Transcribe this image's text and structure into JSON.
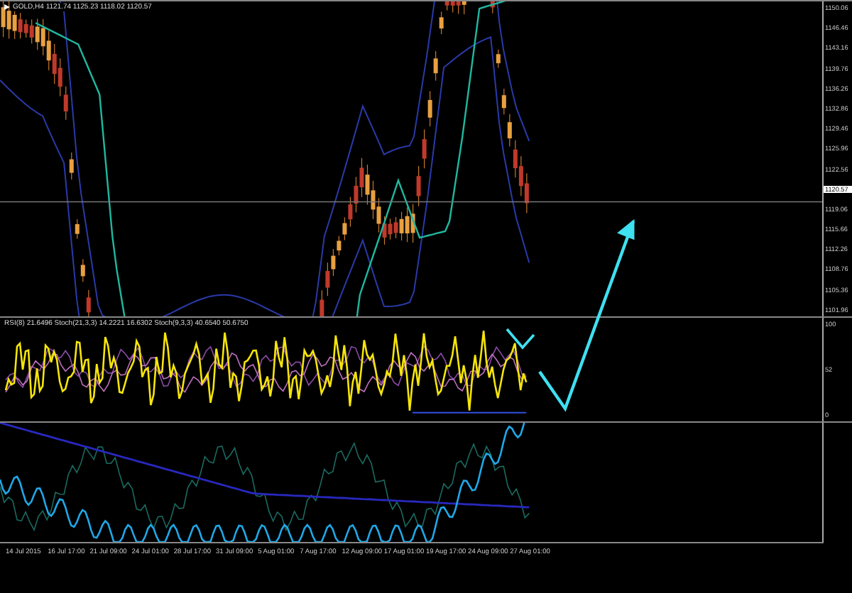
{
  "symbol_header": "GOLD,H4  1121.74 1125.23 1118.02 1120.57",
  "price_axis": [
    {
      "label": "1150.06",
      "kind": "tick"
    },
    {
      "label": "1146.46",
      "kind": "tick"
    },
    {
      "label": "1143.16",
      "kind": "tick"
    },
    {
      "label": "1139.76",
      "kind": "tick"
    },
    {
      "label": "1136.26",
      "kind": "tick"
    },
    {
      "label": "1132.86",
      "kind": "tick"
    },
    {
      "label": "1129.46",
      "kind": "tick"
    },
    {
      "label": "1125.96",
      "kind": "tick"
    },
    {
      "label": "1122.56",
      "kind": "tick"
    },
    {
      "label": "1120.57",
      "kind": "current"
    },
    {
      "label": "1119.06",
      "kind": "tick"
    },
    {
      "label": "1115.66",
      "kind": "tick"
    },
    {
      "label": "1112.26",
      "kind": "tick"
    },
    {
      "label": "1108.76",
      "kind": "tick"
    },
    {
      "label": "1105.36",
      "kind": "tick"
    },
    {
      "label": "1101.96",
      "kind": "tick"
    }
  ],
  "indicator_header": "RSI(8) 21.6496  Stoch(21,3,3) 14.2221 16.6302  Stoch(9,3,3) 40.6540 50.6750",
  "indicator_axis": [
    "100",
    "52",
    "0"
  ],
  "time_axis": [
    "14 Jul 2015",
    "16 Jul 17:00",
    "21 Jul 09:00",
    "24 Jul 01:00",
    "28 Jul 17:00",
    "31 Jul 09:00",
    "5 Aug 01:00",
    "7 Aug 17:00",
    "12 Aug 09:00",
    "17 Aug 01:00",
    "19 Aug 17:00",
    "24 Aug 09:00",
    "27 Aug 01:00"
  ]
}
